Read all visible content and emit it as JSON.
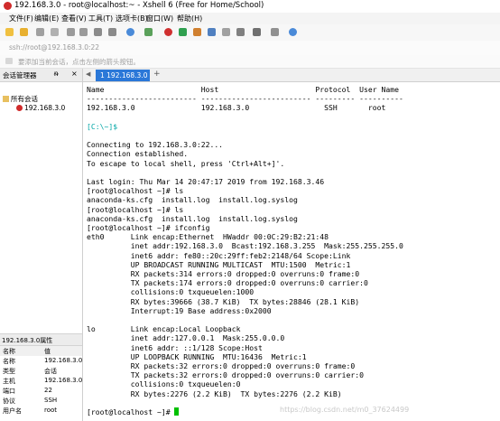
{
  "window": {
    "title": "192.168.3.0 - root@localhost:~ - Xshell 6 (Free for Home/School)"
  },
  "menu": [
    "文件(F)",
    "编辑(E)",
    "查看(V)",
    "工具(T)",
    "选项卡(B)",
    "窗口(W)",
    "帮助(H)"
  ],
  "address": {
    "value": "ssh://root@192.168.3.0:22"
  },
  "hint": {
    "text": "要添加当前会话，点击左侧的箭头按钮。"
  },
  "session_manager": {
    "title": "会话管理器",
    "pin": "ᵰ",
    "close": "×",
    "root": "所有会话",
    "items": [
      "192.168.3.0"
    ]
  },
  "properties": {
    "title": "192.168.3.0属性",
    "header": [
      "名称",
      "值"
    ],
    "rows": [
      [
        "名称",
        "192.168.3.0"
      ],
      [
        "类型",
        "会话"
      ],
      [
        "主机",
        "192.168.3.0"
      ],
      [
        "端口",
        "22"
      ],
      [
        "协议",
        "SSH"
      ],
      [
        "用户名",
        "root"
      ]
    ]
  },
  "tabs": {
    "active": "1 192.168.3.0",
    "add": "+"
  },
  "terminal": {
    "lines": [
      "Name                      Host                      Protocol  User Name",
      "------------------------- ------------------------- --------- ----------",
      "192.168.3.0               192.168.3.0                 SSH       root",
      "",
      "[C:\\~]$",
      "",
      "Connecting to 192.168.3.0:22...",
      "Connection established.",
      "To escape to local shell, press 'Ctrl+Alt+]'.",
      "",
      "Last login: Thu Mar 14 20:47:17 2019 from 192.168.3.46",
      "[root@localhost ~]# ls",
      "anaconda-ks.cfg  install.log  install.log.syslog",
      "[root@localhost ~]# ls",
      "anaconda-ks.cfg  install.log  install.log.syslog",
      "[root@localhost ~]# ifconfig",
      "eth0      Link encap:Ethernet  HWaddr 00:0C:29:B2:21:48",
      "          inet addr:192.168.3.0  Bcast:192.168.3.255  Mask:255.255.255.0",
      "          inet6 addr: fe80::20c:29ff:feb2:2148/64 Scope:Link",
      "          UP BROADCAST RUNNING MULTICAST  MTU:1500  Metric:1",
      "          RX packets:314 errors:0 dropped:0 overruns:0 frame:0",
      "          TX packets:174 errors:0 dropped:0 overruns:0 carrier:0",
      "          collisions:0 txqueuelen:1000",
      "          RX bytes:39666 (38.7 KiB)  TX bytes:28846 (28.1 KiB)",
      "          Interrupt:19 Base address:0x2000",
      "",
      "lo        Link encap:Local Loopback",
      "          inet addr:127.0.0.1  Mask:255.0.0.0",
      "          inet6 addr: ::1/128 Scope:Host",
      "          UP LOOPBACK RUNNING  MTU:16436  Metric:1",
      "          RX packets:32 errors:0 dropped:0 overruns:0 frame:0",
      "          TX packets:32 errors:0 dropped:0 overruns:0 carrier:0",
      "          collisions:0 txqueuelen:0",
      "          RX bytes:2276 (2.2 KiB)  TX bytes:2276 (2.2 KiB)",
      "",
      "[root@localhost ~]# "
    ],
    "highlight_line": 4
  },
  "watermark": "https://blog.csdn.net/m0_37624499",
  "colors": {
    "accent": "#2b78d8",
    "prompt": "#00a6a6",
    "cursor": "#00c000",
    "logo": "#d02b2b"
  }
}
